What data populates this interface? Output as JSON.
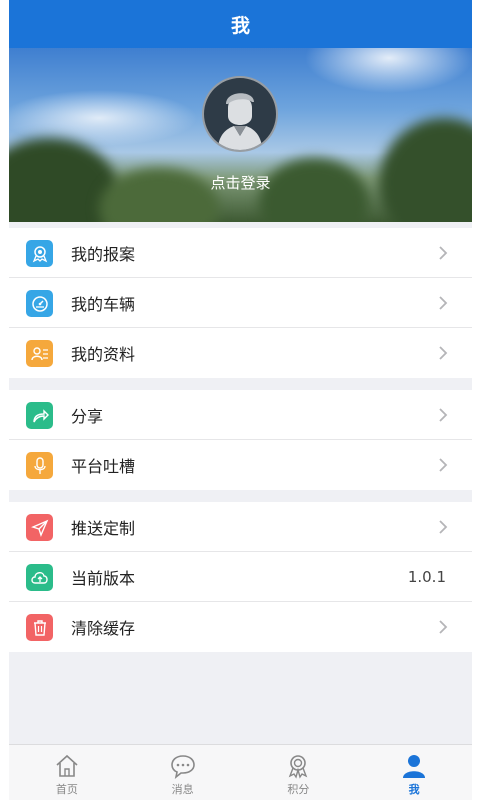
{
  "header": {
    "title": "我"
  },
  "profile": {
    "login_text": "点击登录"
  },
  "groups": [
    {
      "items": [
        {
          "label": "我的报案",
          "icon": "badge-icon",
          "color": "#36a6e6"
        },
        {
          "label": "我的车辆",
          "icon": "speedometer-icon",
          "color": "#36a6e6"
        },
        {
          "label": "我的资料",
          "icon": "profile-card-icon",
          "color": "#f5a83c"
        }
      ]
    },
    {
      "items": [
        {
          "label": "分享",
          "icon": "share-icon",
          "color": "#2bbc8a"
        },
        {
          "label": "平台吐槽",
          "icon": "microphone-icon",
          "color": "#f5a83c"
        }
      ]
    },
    {
      "items": [
        {
          "label": "推送定制",
          "icon": "paper-plane-icon",
          "color": "#f26465"
        },
        {
          "label": "当前版本",
          "icon": "cloud-upload-icon",
          "color": "#2bbc8a",
          "value": "1.0.1"
        },
        {
          "label": "清除缓存",
          "icon": "trash-icon",
          "color": "#f26465"
        }
      ]
    }
  ],
  "tabbar": {
    "tabs": [
      {
        "label": "首页",
        "icon": "home-icon"
      },
      {
        "label": "消息",
        "icon": "chat-bubble-icon"
      },
      {
        "label": "积分",
        "icon": "medal-icon"
      },
      {
        "label": "我",
        "icon": "person-icon",
        "active": true
      }
    ]
  },
  "colors": {
    "header": "#1b74d8",
    "active_tab": "#1b74d8",
    "background": "#eff0f4"
  }
}
